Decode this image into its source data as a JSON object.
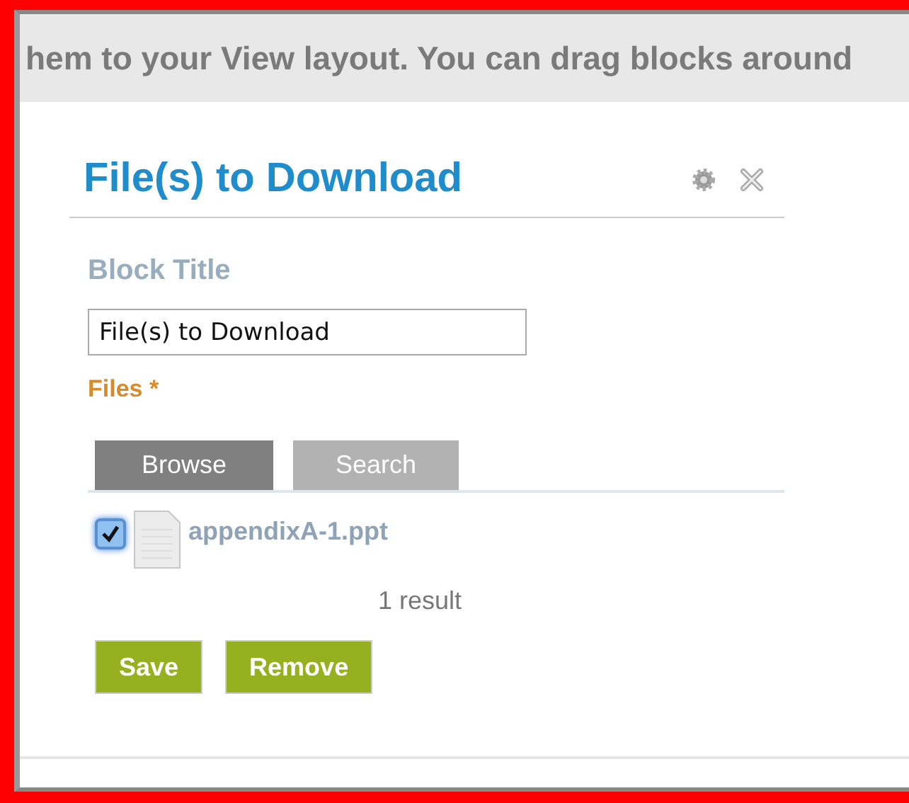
{
  "banner": {
    "text": "hem to your View layout. You can drag blocks around"
  },
  "block": {
    "title": "File(s) to Download"
  },
  "block_title_field": {
    "label": "Block Title",
    "value": "File(s) to Download"
  },
  "files": {
    "label": "Files *",
    "tabs": [
      {
        "label": "Browse",
        "selected": true
      },
      {
        "label": "Search",
        "selected": false
      }
    ],
    "items": [
      {
        "name": "appendixA-1.ppt",
        "checked": true
      }
    ],
    "result_count": "1 result"
  },
  "buttons": [
    "Save",
    "Remove"
  ]
}
